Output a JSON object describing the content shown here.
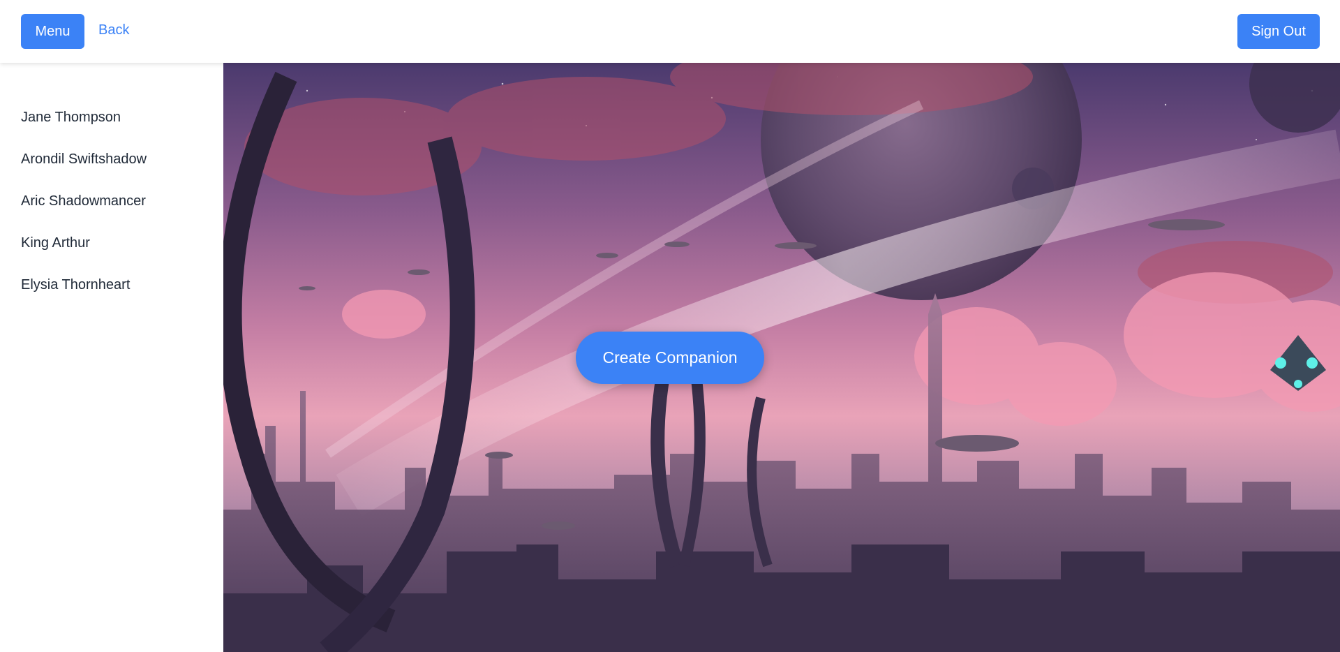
{
  "header": {
    "menu_label": "Menu",
    "back_label": "Back",
    "sign_out_label": "Sign Out"
  },
  "sidebar": {
    "items": [
      {
        "label": "Jane Thompson"
      },
      {
        "label": "Arondil Swiftshadow"
      },
      {
        "label": "Aric Shadowmancer"
      },
      {
        "label": "King Arthur"
      },
      {
        "label": "Elysia Thornheart"
      }
    ]
  },
  "main": {
    "create_label": "Create Companion"
  },
  "colors": {
    "accent": "#3b82f6",
    "text": "#1f2937",
    "background": "#ffffff"
  }
}
